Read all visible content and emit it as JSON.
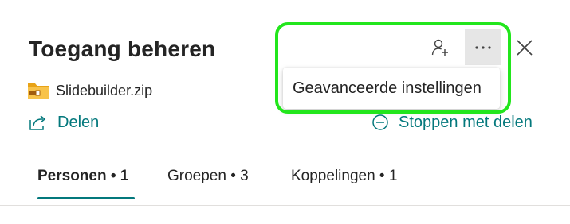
{
  "panel": {
    "title": "Toegang beheren",
    "file_name": "Slidebuilder.zip",
    "share_label": "Delen",
    "stop_sharing_label": "Stoppen met delen"
  },
  "tabs": [
    {
      "label": "Personen • 1",
      "active": true
    },
    {
      "label": "Groepen • 3",
      "active": false
    },
    {
      "label": "Koppelingen • 1",
      "active": false
    }
  ],
  "toolbar": {
    "icons": [
      "add-person-icon",
      "more-options-icon",
      "close-icon"
    ]
  },
  "more_menu": {
    "items": [
      {
        "label": "Geavanceerde instellingen"
      }
    ]
  },
  "colors": {
    "accent": "#03787c",
    "highlight": "#22e61c",
    "folder": "#f8c34a"
  }
}
